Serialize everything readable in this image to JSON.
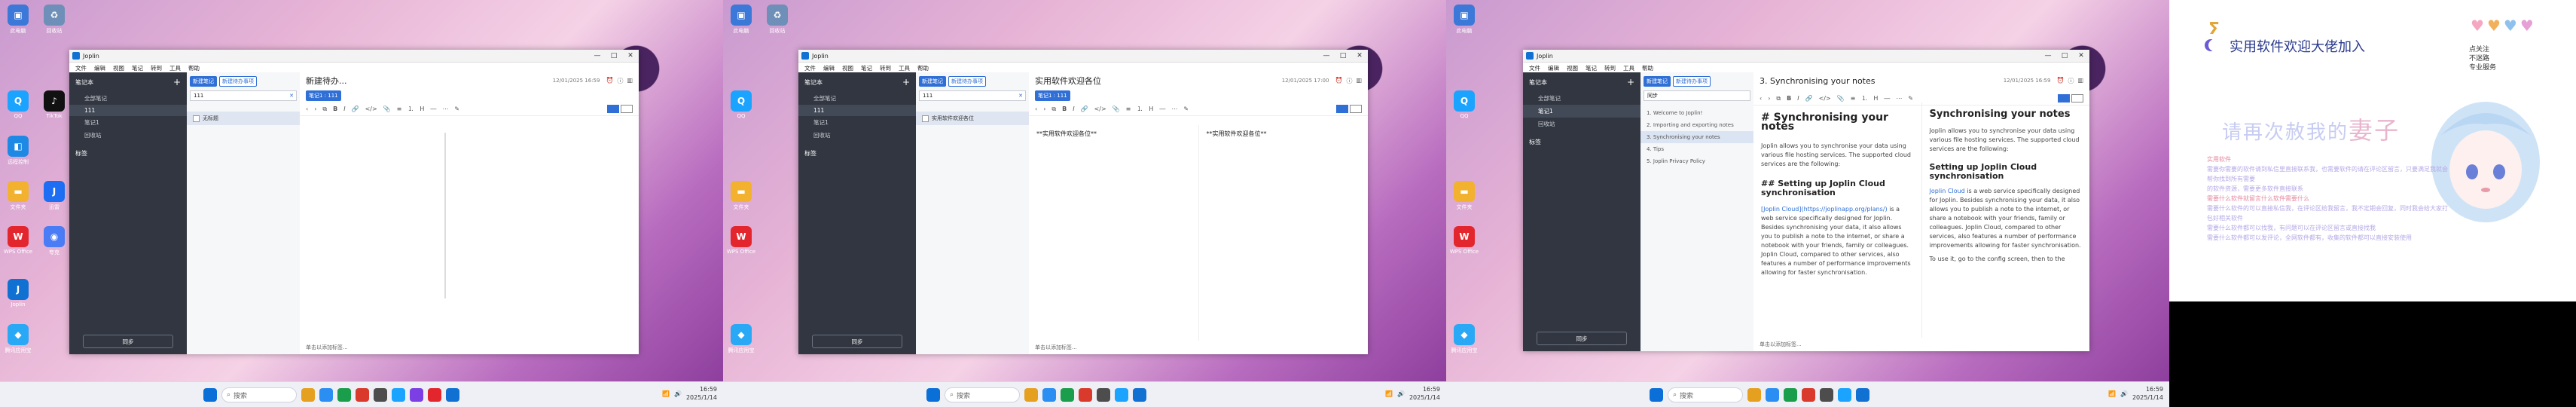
{
  "desktop": {
    "icons": [
      {
        "label": "此电脑",
        "color": "#3b78d8",
        "glyph": "▣"
      },
      {
        "label": "回收站",
        "color": "#6e8fb8",
        "glyph": "♻"
      },
      {
        "label": "QQ",
        "color": "#1aa3ff",
        "glyph": "Q"
      },
      {
        "label": "TikTok",
        "color": "#111111",
        "glyph": "♪"
      },
      {
        "label": "远程控制",
        "color": "#1e88e5",
        "glyph": "◧"
      },
      {
        "label": "迅雷",
        "color": "#1d6ef2",
        "glyph": "J"
      },
      {
        "label": "文件夹",
        "color": "#f2b230",
        "glyph": "▬"
      },
      {
        "label": "夸克",
        "color": "#4a7cf6",
        "glyph": "◉"
      },
      {
        "label": "WPS Office",
        "color": "#e3262e",
        "glyph": "W"
      },
      {
        "label": "Joplin",
        "color": "#1071d3",
        "glyph": "J"
      },
      {
        "label": "腾讯应用宝",
        "color": "#29a8f5",
        "glyph": "◆"
      }
    ]
  },
  "taskbar": {
    "search_placeholder": "搜索",
    "time": "16:59",
    "date": "2025/1/14",
    "time2": "16:59",
    "time3": "16:59",
    "icon_colors": [
      "#0b6fd8",
      "#e6a020",
      "#2b8ef2",
      "#1b9e4b",
      "#d93a2b",
      "#4d4d4d",
      "#1aa3ff",
      "#7b3fe4",
      "#e3262e",
      "#1071d3",
      "#222222"
    ]
  },
  "app": {
    "title": "Joplin",
    "window_controls": [
      "—",
      "□",
      "✕"
    ],
    "menu": [
      "文件",
      "编辑",
      "视图",
      "笔记",
      "转到",
      "工具",
      "帮助"
    ],
    "sidebar": {
      "notebooks_label": "笔记本",
      "add_icon": "+",
      "items": [
        "全部笔记",
        "111",
        "笔记1",
        "回收站"
      ],
      "items3": [
        "全部笔记",
        "笔记1",
        "回收站"
      ],
      "tags_label": "标签",
      "sync_label": "同步"
    },
    "notelist": {
      "new_note": "新建笔记",
      "new_todo": "新建待办事项",
      "search_value": "111",
      "search_value3": "同步",
      "panel1_item": "无标题",
      "panel2_item": "实用软件欢迎各位",
      "panel3_items": [
        "1. Welcome to Joplin!",
        "2. Importing and exporting notes",
        "3. Synchronising your notes",
        "4. Tips",
        "5. Joplin Privacy Policy"
      ]
    },
    "editor": {
      "title1": "新建待办...",
      "title2": "实用软件欢迎各位",
      "title3": "3. Synchronising your notes",
      "date": "12/01/2025 16:59",
      "date2": "12/01/2025 17:00",
      "date3": "12/01/2025 16:59",
      "notebook_badge": "笔记1 : 111",
      "status": "单击以添加标签...",
      "panel2_source": "**实用软件欢迎各位**",
      "panel2_preview": "**实用软件欢迎各位**",
      "md_h1": "# Synchronising your notes",
      "md_intro": "Joplin allows you to synchronise your data using various file hosting services. The supported cloud services are the following:",
      "md_h2": "## Setting up Joplin Cloud synchronisation",
      "md_p2_link": "[Joplin Cloud](https://joplinapp.org/plans/)",
      "md_p2": " is a web service specifically designed for Joplin. Besides synchronising your data, it also allows you to publish a note to the internet, or share a notebook with your friends, family or colleagues. Joplin Cloud, compared to other services, also features a number of performance improvements allowing for faster synchronisation.",
      "rv_h1": "Synchronising your notes",
      "rv_intro": "Joplin allows you to synchronise your data using various file hosting services. The supported cloud services are the following:",
      "rv_h2": "Setting up Joplin Cloud synchronisation",
      "rv_p2_link": "Joplin Cloud",
      "rv_p2": " is a web service specifically designed for Joplin. Besides synchronising your data, it also allows you to publish a note to the internet, or share a notebook with your friends, family or colleagues. Joplin Cloud, compared to other services, also features a number of performance improvements allowing for faster synchronisation.",
      "rv_p3": "To use it, go to the config screen, then to the"
    }
  },
  "promo": {
    "title": "实用软件欢迎大佬加入",
    "corner_line1": "点关注",
    "corner_line2": "不迷路",
    "corner_line3": "专业服务",
    "big_text_a": "请再次赦我的",
    "big_text_b": "妻子",
    "lines": [
      "实用软件",
      "需要你需要的软件请到私信里直接联系我，也需要软件的请在评论区留言，只要满足我就会帮你找到所有需要",
      "的软件资源，需要更多软件直接联系",
      "需要什么软件就留言什么软件需要什么",
      "需要什么软件的可以直接私信我，在评论区给我留言，我不定期会回复，同时我会给大家打包好相关软件",
      "需要什么软件都可以找我，有问题可以在评论区留言或直接找我",
      "需要什么软件都可以发评论，全网软件都有，收集的软件都可以直接安装使用"
    ]
  }
}
